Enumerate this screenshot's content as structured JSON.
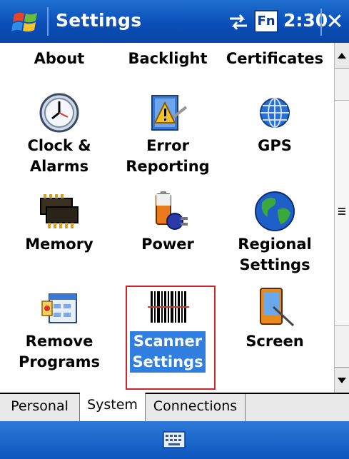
{
  "titlebar": {
    "title": "Settings",
    "fn_label": "Fn",
    "time": "2:30",
    "close_label": "✕"
  },
  "items": [
    {
      "label": "About",
      "icon": "info-icon"
    },
    {
      "label": "Backlight",
      "icon": "backlight-icon"
    },
    {
      "label": "Certificates",
      "icon": "certificate-icon"
    },
    {
      "label": "Clock &\nAlarms",
      "icon": "clock-icon"
    },
    {
      "label": "Error\nReporting",
      "icon": "error-report-icon"
    },
    {
      "label": "GPS",
      "icon": "globe-gps-icon"
    },
    {
      "label": "Memory",
      "icon": "memory-chip-icon"
    },
    {
      "label": "Power",
      "icon": "battery-plug-icon"
    },
    {
      "label": "Regional\nSettings",
      "icon": "earth-icon"
    },
    {
      "label": "Remove\nPrograms",
      "icon": "remove-programs-icon"
    },
    {
      "label": "Scanner\nSettings",
      "icon": "barcode-icon",
      "selected": true
    },
    {
      "label": "Screen",
      "icon": "pda-stylus-icon"
    }
  ],
  "tabs": [
    {
      "label": "Personal"
    },
    {
      "label": "System",
      "active": true
    },
    {
      "label": "Connections"
    }
  ],
  "colors": {
    "title_bar": "#0b4fb8",
    "selection": "#2f7ee0",
    "highlight_border": "#d0232a"
  }
}
